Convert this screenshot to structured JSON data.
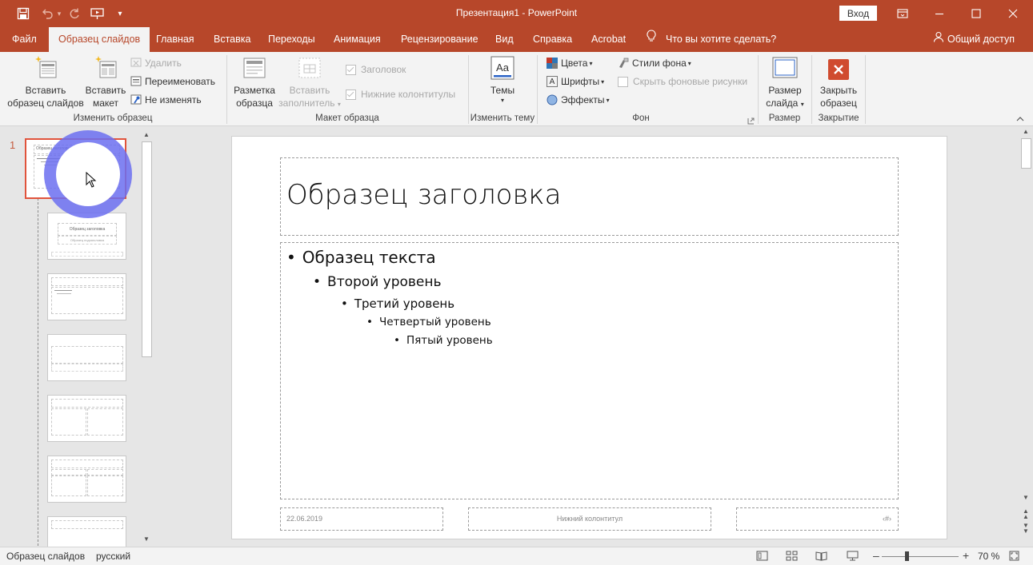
{
  "titlebar": {
    "title": "Презентация1 - PowerPoint",
    "signin_label": "Вход",
    "accent": "#b7472a",
    "icons": [
      "save-icon",
      "undo-icon",
      "redo-icon",
      "start-from-beginning-icon",
      "customize-qat-icon",
      "ribbon-display-options-icon",
      "minimize-icon",
      "maximize-icon",
      "close-icon"
    ]
  },
  "tabs": {
    "items": [
      "Файл",
      "Образец слайдов",
      "Главная",
      "Вставка",
      "Переходы",
      "Анимация",
      "Рецензирование",
      "Вид",
      "Справка",
      "Acrobat"
    ],
    "active": "Образец слайдов",
    "tell_me": "Что вы хотите сделать?",
    "share": "Общий доступ"
  },
  "ribbon": {
    "edit_master": {
      "label": "Изменить образец",
      "insert_slide_master_l1": "Вставить",
      "insert_slide_master_l2": "образец слайдов",
      "insert_layout_l1": "Вставить",
      "insert_layout_l2": "макет",
      "delete": "Удалить",
      "rename": "Переименовать",
      "preserve": "Не изменять"
    },
    "master_layout": {
      "label": "Макет образца",
      "master_layout_l1": "Разметка",
      "master_layout_l2": "образца",
      "insert_placeholder_l1": "Вставить",
      "insert_placeholder_l2": "заполнитель",
      "title_chk": "Заголовок",
      "footers_chk": "Нижние колонтитулы"
    },
    "edit_theme": {
      "label": "Изменить тему",
      "themes": "Темы",
      "themes_glyph": "Aa"
    },
    "background": {
      "label": "Фон",
      "colors": "Цвета",
      "fonts": "Шрифты",
      "fonts_glyph": "A",
      "effects": "Эффекты",
      "bg_styles": "Стили фона",
      "hide_bg": "Скрыть фоновые рисунки"
    },
    "size": {
      "label": "Размер",
      "slide_size_l1": "Размер",
      "slide_size_l2": "слайда"
    },
    "close": {
      "label": "Закрытие",
      "close_l1": "Закрыть",
      "close_l2": "образец"
    }
  },
  "thumbnails": {
    "selected_number": "1",
    "master_thumb_title": "Образец заголовка",
    "layout_thumb_title": "Образец заголовка",
    "layout_thumb_subtitle": "Образец подзаголовка",
    "count": 7,
    "selection_color": "#e0533c",
    "click_highlight_color": "#6b6ff0"
  },
  "slide": {
    "title": "Образец заголовка",
    "levels": [
      "Образец текста",
      "Второй уровень",
      "Третий уровень",
      "Четвертый уровень",
      "Пятый уровень"
    ],
    "date": "22.06.2019",
    "footer": "Нижний колонтитул",
    "slide_number": "‹#›"
  },
  "statusbar": {
    "view_name": "Образец слайдов",
    "language": "русский",
    "zoom": "70 %",
    "minus": "–",
    "plus": "+",
    "icons": [
      "normal-view-icon",
      "slide-sorter-icon",
      "reading-view-icon",
      "slideshow-icon",
      "fit-to-window-icon"
    ]
  }
}
